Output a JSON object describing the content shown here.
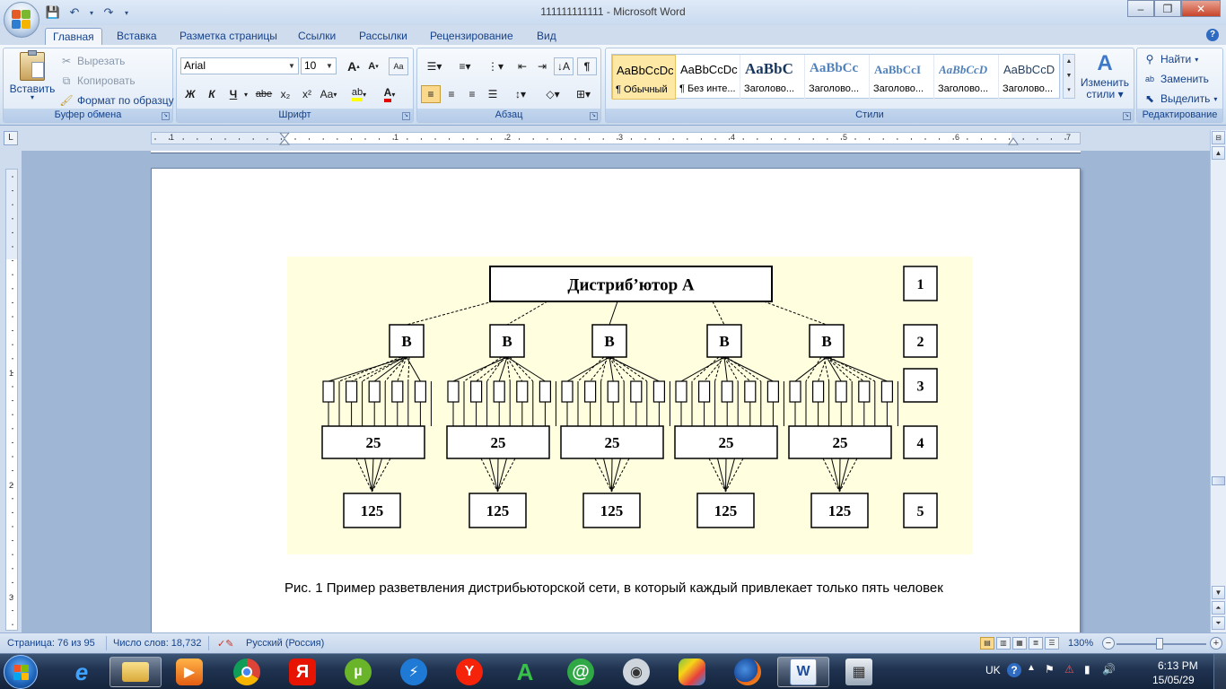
{
  "window": {
    "title": "111111111111 - Microsoft Word",
    "controls": [
      "–",
      "❐",
      "✕"
    ]
  },
  "tabs": [
    "Главная",
    "Вставка",
    "Разметка страницы",
    "Ссылки",
    "Рассылки",
    "Рецензирование",
    "Вид"
  ],
  "ribbon": {
    "clipboard": {
      "label": "Буфер обмена",
      "paste": "Вставить",
      "cut": "Вырезать",
      "copy": "Копировать",
      "format_painter": "Формат по образцу"
    },
    "font": {
      "label": "Шрифт",
      "font_name": "Arial",
      "font_size": "10",
      "grow": "A",
      "shrink": "A",
      "bold": "Ж",
      "italic": "К",
      "underline": "Ч",
      "strike": "abe",
      "subscript": "x₂",
      "superscript": "x²",
      "change_case": "Aa"
    },
    "paragraph": {
      "label": "Абзац",
      "pilcrow": "¶"
    },
    "styles": {
      "label": "Стили",
      "items": [
        {
          "sample": "AaBbCcDc",
          "name": "¶ Обычный"
        },
        {
          "sample": "AaBbCcDc",
          "name": "¶ Без инте..."
        },
        {
          "sample": "AaBbC",
          "name": "Заголово..."
        },
        {
          "sample": "AaBbCc",
          "name": "Заголово..."
        },
        {
          "sample": "AaBbCcI",
          "name": "Заголово..."
        },
        {
          "sample": "AaBbCcD",
          "name": "Заголово..."
        },
        {
          "sample": "AaBbCcD",
          "name": "Заголово..."
        }
      ],
      "change_styles_line1": "Изменить",
      "change_styles_line2": "стили"
    },
    "editing": {
      "label": "Редактирование",
      "find": "Найти",
      "replace": "Заменить",
      "select": "Выделить"
    }
  },
  "ruler": {
    "h_labels": [
      "1",
      "1",
      "2",
      "3",
      "4",
      "5",
      "6",
      "7"
    ],
    "v_labels": [
      "1",
      "2",
      "3"
    ]
  },
  "diagram": {
    "top_box": "Дистриб’ютор А",
    "level2_label": "В",
    "level4_label": "25",
    "level5_label": "125",
    "levels": [
      "1",
      "2",
      "3",
      "4",
      "5"
    ]
  },
  "caption": "Рис. 1 Пример разветвления дистрибьюторской сети, в который каждый привлекает только пять человек",
  "status": {
    "page": "Страница: 76 из 95",
    "words": "Число слов: 18,732",
    "language": "Русский (Россия)",
    "zoom": "130%",
    "zoom_fraction": 0.48
  },
  "taskbar": {
    "lang": "UK",
    "time": "6:13 PM",
    "date": "15/05/29",
    "apps": [
      "explorer",
      "ie",
      "media",
      "chrome",
      "yandex",
      "utorrent",
      "speed",
      "yandex-browser",
      "acrobat",
      "mail",
      "camera",
      "bluestacks",
      "firefox",
      "word",
      "calc"
    ]
  },
  "colors": {
    "figure_bg": "#ffffe0",
    "ribbon_text": "#15428b",
    "accent": "#2f6bc1"
  }
}
